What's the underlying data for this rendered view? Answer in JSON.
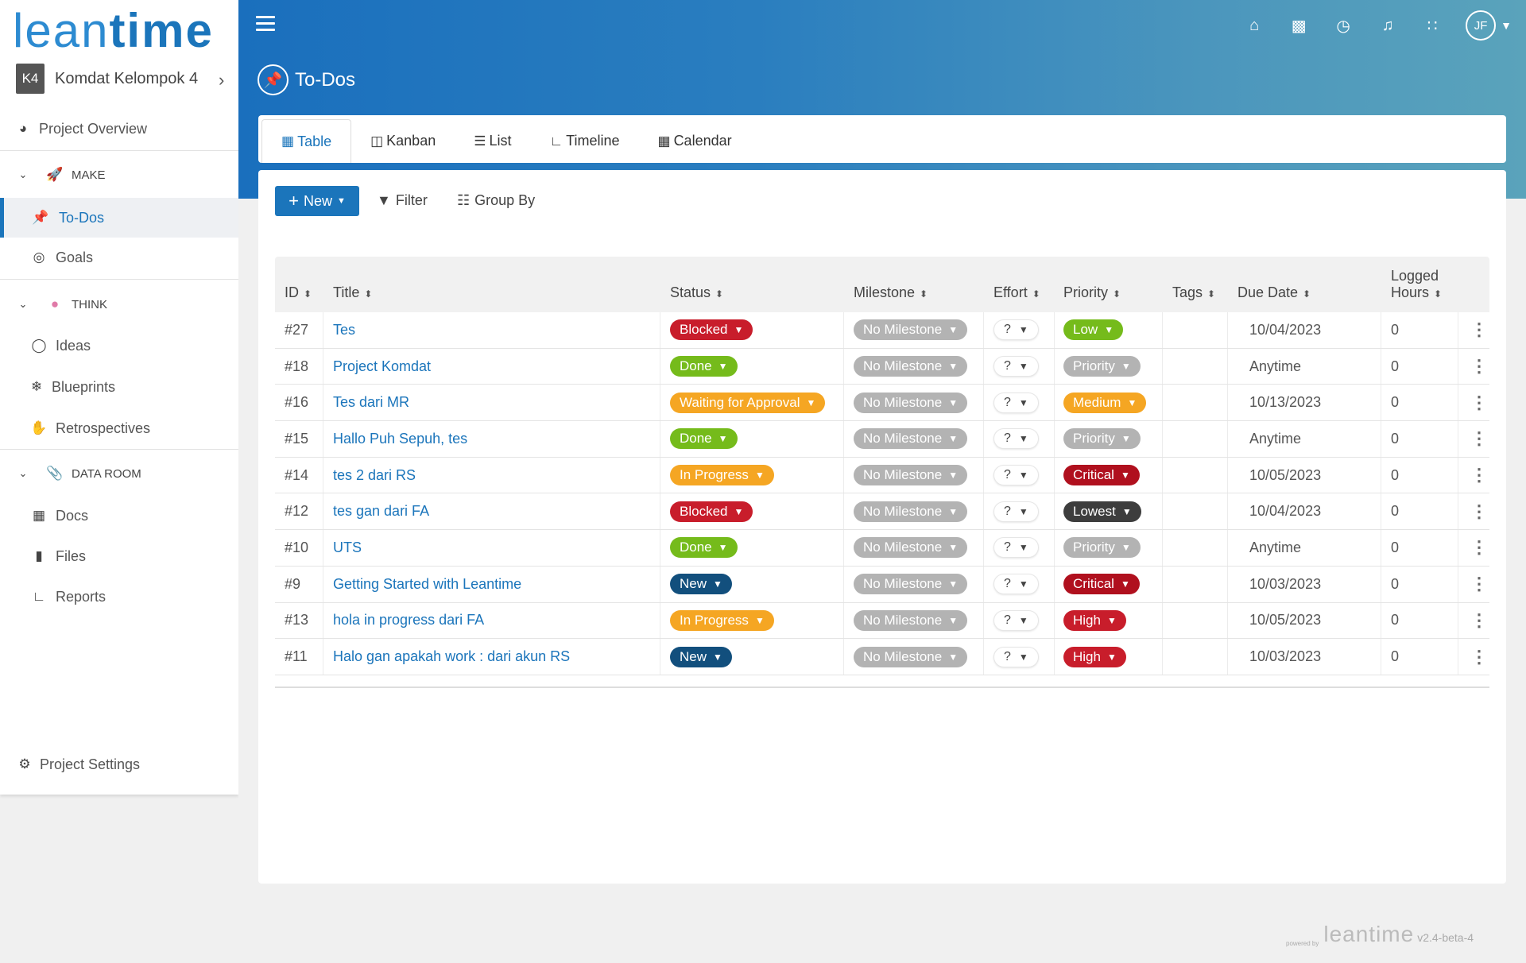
{
  "app": {
    "logo_light": "lean",
    "logo_bold": "time"
  },
  "project": {
    "badge": "K4",
    "name": "Komdat Kelompok 4"
  },
  "sidebar": {
    "overview": "Project Overview",
    "make_label": "MAKE",
    "todos": "To-Dos",
    "goals": "Goals",
    "think_label": "THINK",
    "ideas": "Ideas",
    "blueprints": "Blueprints",
    "retrospectives": "Retrospectives",
    "dataroom_label": "DATA ROOM",
    "docs": "Docs",
    "files": "Files",
    "reports": "Reports",
    "settings": "Project Settings"
  },
  "header": {
    "avatar": "JF",
    "title": "To-Dos"
  },
  "tabs": [
    "Table",
    "Kanban",
    "List",
    "Timeline",
    "Calendar"
  ],
  "toolbar": {
    "new": "New",
    "filter": "Filter",
    "group_by": "Group By"
  },
  "columns": {
    "id": "ID",
    "title": "Title",
    "status": "Status",
    "milestone": "Milestone",
    "effort": "Effort",
    "priority": "Priority",
    "tags": "Tags",
    "due": "Due Date",
    "logged1": "Logged",
    "logged2": "Hours"
  },
  "rows": [
    {
      "id": "#27",
      "title": "Tes",
      "status": "Blocked",
      "milestone": "No Milestone",
      "effort": "?",
      "priority": "Low",
      "due": "10/04/2023",
      "hours": "0"
    },
    {
      "id": "#18",
      "title": "Project Komdat",
      "status": "Done",
      "milestone": "No Milestone",
      "effort": "?",
      "priority": "Priority",
      "due": "Anytime",
      "hours": "0"
    },
    {
      "id": "#16",
      "title": "Tes dari MR",
      "status": "Waiting for Approval",
      "milestone": "No Milestone",
      "effort": "?",
      "priority": "Medium",
      "due": "10/13/2023",
      "hours": "0"
    },
    {
      "id": "#15",
      "title": "Hallo Puh Sepuh, tes",
      "status": "Done",
      "milestone": "No Milestone",
      "effort": "?",
      "priority": "Priority",
      "due": "Anytime",
      "hours": "0"
    },
    {
      "id": "#14",
      "title": "tes 2 dari RS",
      "status": "In Progress",
      "milestone": "No Milestone",
      "effort": "?",
      "priority": "Critical",
      "due": "10/05/2023",
      "hours": "0"
    },
    {
      "id": "#12",
      "title": "tes gan dari FA",
      "status": "Blocked",
      "milestone": "No Milestone",
      "effort": "?",
      "priority": "Lowest",
      "due": "10/04/2023",
      "hours": "0"
    },
    {
      "id": "#10",
      "title": "UTS",
      "status": "Done",
      "milestone": "No Milestone",
      "effort": "?",
      "priority": "Priority",
      "due": "Anytime",
      "hours": "0"
    },
    {
      "id": "#9",
      "title": "Getting Started with Leantime",
      "status": "New",
      "milestone": "No Milestone",
      "effort": "?",
      "priority": "Critical",
      "due": "10/03/2023",
      "hours": "0"
    },
    {
      "id": "#13",
      "title": "hola in progress dari FA",
      "status": "In Progress",
      "milestone": "No Milestone",
      "effort": "?",
      "priority": "High",
      "due": "10/05/2023",
      "hours": "0"
    },
    {
      "id": "#11",
      "title": "Halo gan apakah work : dari akun RS",
      "status": "New",
      "milestone": "No Milestone",
      "effort": "?",
      "priority": "High",
      "due": "10/03/2023",
      "hours": "0"
    }
  ],
  "colors": {
    "Blocked": "#c81d2b",
    "Done": "#75bb1b",
    "Waiting for Approval": "#f5a623",
    "In Progress": "#f5a623",
    "New": "#124f7d",
    "No Milestone": "#b3b3b3",
    "Low": "#75bb1b",
    "Priority": "#b3b3b3",
    "Medium": "#f5a623",
    "Critical": "#b0101e",
    "Lowest": "#3d3d3d",
    "High": "#c81d2b"
  },
  "footer": {
    "powered": "powered by",
    "logo": "leantime",
    "version": "v2.4-beta-4"
  }
}
